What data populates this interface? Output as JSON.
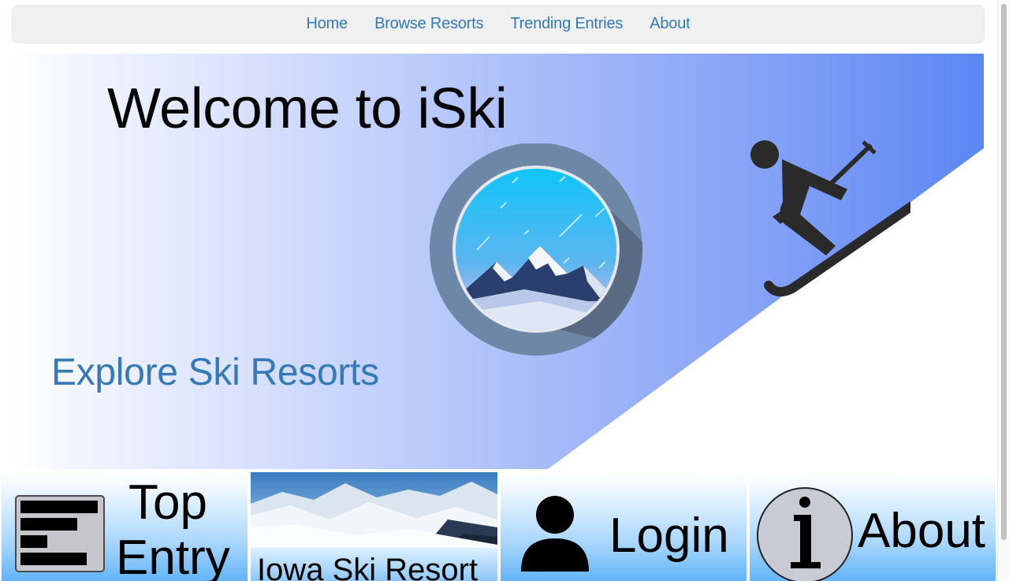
{
  "nav": {
    "items": [
      {
        "label": "Home"
      },
      {
        "label": "Browse Resorts"
      },
      {
        "label": "Trending Entries"
      },
      {
        "label": "About"
      }
    ]
  },
  "hero": {
    "title": "Welcome to iSki",
    "explore_link": "Explore Ski Resorts"
  },
  "tiles": {
    "top_entry": {
      "line1": "Top",
      "line2": "Entry"
    },
    "resort": {
      "label": "Iowa Ski Resort"
    },
    "login": {
      "label": "Login"
    },
    "about": {
      "label": "About"
    }
  },
  "icons": {
    "logo": "mountain-lens-logo",
    "skier": "skier-icon",
    "top_entry": "leaderboard-icon",
    "login": "user-icon",
    "about": "info-icon"
  },
  "colors": {
    "link": "#337ab7",
    "navbar_bg": "#f0f0f0",
    "hero_gradient_end": "#5b87f4",
    "tile_gradient_end": "#62b4f7"
  }
}
